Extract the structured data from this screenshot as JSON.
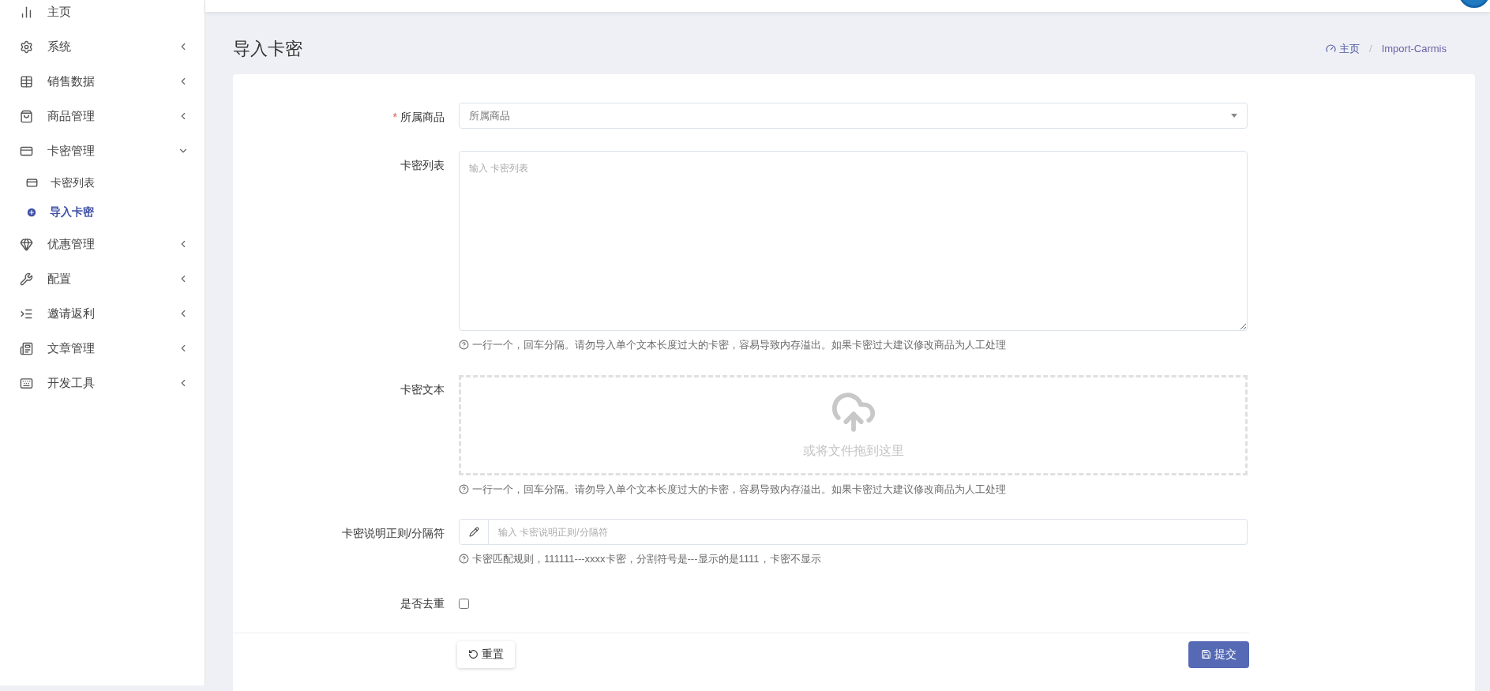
{
  "sidebar": {
    "items": [
      {
        "label": "主页",
        "kind": "link"
      },
      {
        "label": "系统",
        "kind": "group",
        "expanded": false
      },
      {
        "label": "销售数据",
        "kind": "group",
        "expanded": false
      },
      {
        "label": "商品管理",
        "kind": "group",
        "expanded": false
      },
      {
        "label": "卡密管理",
        "kind": "group",
        "expanded": true,
        "children": [
          {
            "label": "卡密列表",
            "selected": false
          },
          {
            "label": "导入卡密",
            "selected": true
          }
        ]
      },
      {
        "label": "优惠管理",
        "kind": "group",
        "expanded": false
      },
      {
        "label": "配置",
        "kind": "group",
        "expanded": false
      },
      {
        "label": "邀请返利",
        "kind": "group",
        "expanded": false
      },
      {
        "label": "文章管理",
        "kind": "group",
        "expanded": false
      },
      {
        "label": "开发工具",
        "kind": "group",
        "expanded": false
      }
    ]
  },
  "page_title": "导入卡密",
  "breadcrumb": {
    "items": [
      "主页",
      "Import-Carmis"
    ],
    "separator": "/"
  },
  "form": {
    "fields": [
      {
        "kind": "select",
        "label": "所属商品",
        "required_mark": "*",
        "placeholder": "所属商品"
      },
      {
        "kind": "textarea",
        "label": "卡密列表",
        "placeholder": "输入 卡密列表",
        "help": "一行一个，回车分隔。请勿导入单个文本长度过大的卡密，容易导致内存溢出。如果卡密过大建议修改商品为人工处理"
      },
      {
        "kind": "dropzone",
        "label": "卡密文本",
        "prompt": "或将文件拖到这里",
        "help": "一行一个，回车分隔。请勿导入单个文本长度过大的卡密，容易导致内存溢出。如果卡密过大建议修改商品为人工处理"
      },
      {
        "kind": "input",
        "label": "卡密说明正则/分隔符",
        "placeholder": "输入 卡密说明正则/分隔符",
        "help": "卡密匹配规则，111111---xxxx卡密，分割符号是---显示的是1111，卡密不显示"
      },
      {
        "kind": "checkbox",
        "label": "是否去重",
        "checked": false
      }
    ],
    "buttons": [
      {
        "kind": "reset",
        "label": "重置"
      },
      {
        "kind": "submit",
        "label": "提交"
      }
    ]
  }
}
